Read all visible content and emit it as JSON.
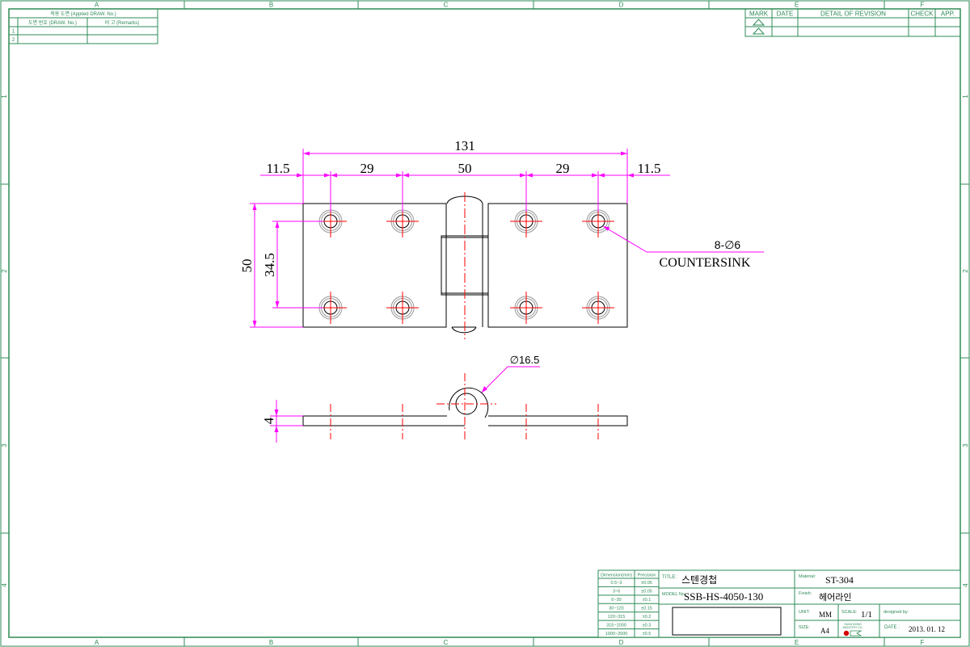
{
  "border": {
    "col_labels": [
      "A",
      "B",
      "C",
      "D",
      "E",
      "F"
    ],
    "row_labels": [
      "1",
      "2",
      "3",
      "4"
    ]
  },
  "applied_table": {
    "title": "적용 도면 (Applied DRAW. No.)",
    "col1": "도면 번호 (DRAW. No.)",
    "col2": "비 고 (Remarks)",
    "rows": [
      "1",
      "2"
    ]
  },
  "revision_table": {
    "headers": [
      "MARK",
      "DATE",
      "DETAIL OF REVISION",
      "CHECK",
      "APP."
    ]
  },
  "drawing": {
    "dim_overall": "131",
    "dim_end_left": "11.5",
    "dim_pitch_left": "29",
    "dim_center": "50",
    "dim_pitch_right": "29",
    "dim_end_right": "11.5",
    "dim_height": "50",
    "dim_hole_spacing": "34.5",
    "hole_note": "8-∅6",
    "hole_note_2": "COUNTERSINK",
    "dim_knuckle": "∅16.5",
    "dim_thickness": "4"
  },
  "tolerance_table": {
    "header_dim": "Dimension(mm)",
    "header_prec": "Precision",
    "rows": [
      {
        "range": "0.5~3",
        "tol": "±0.05"
      },
      {
        "range": "3~6",
        "tol": "±0.05"
      },
      {
        "range": "6~30",
        "tol": "±0.1"
      },
      {
        "range": "30~120",
        "tol": "±0.15"
      },
      {
        "range": "120~315",
        "tol": "±0.2"
      },
      {
        "range": "315~1000",
        "tol": "±0.3"
      },
      {
        "range": "1000~2000",
        "tol": "±0.5"
      }
    ]
  },
  "title_block": {
    "title_label": "TITLE:",
    "title": "스텐경첩",
    "model_label": "MODEL No.",
    "model": "SSB-HS-4050-130",
    "material_label": "Material:",
    "material": "ST-304",
    "finish_label": "Finish:",
    "finish": "헤어라인",
    "unit_label": "UNIT:",
    "unit": "MM",
    "scale_label": "SCALE:",
    "scale": "1/1",
    "designed_label": "designed by:",
    "size_label": "SIZE:",
    "size": "A4",
    "date_label": "DATE :",
    "date": "2013. 01. 12",
    "logo_text_1": "SUNG BONG",
    "logo_text_2": "INDUSTRY CO."
  },
  "colors": {
    "frame": "#2e8b57",
    "dimension": "#ff00ff",
    "centerline": "#ff0000",
    "outline": "#000000",
    "countersink": "#999999"
  }
}
